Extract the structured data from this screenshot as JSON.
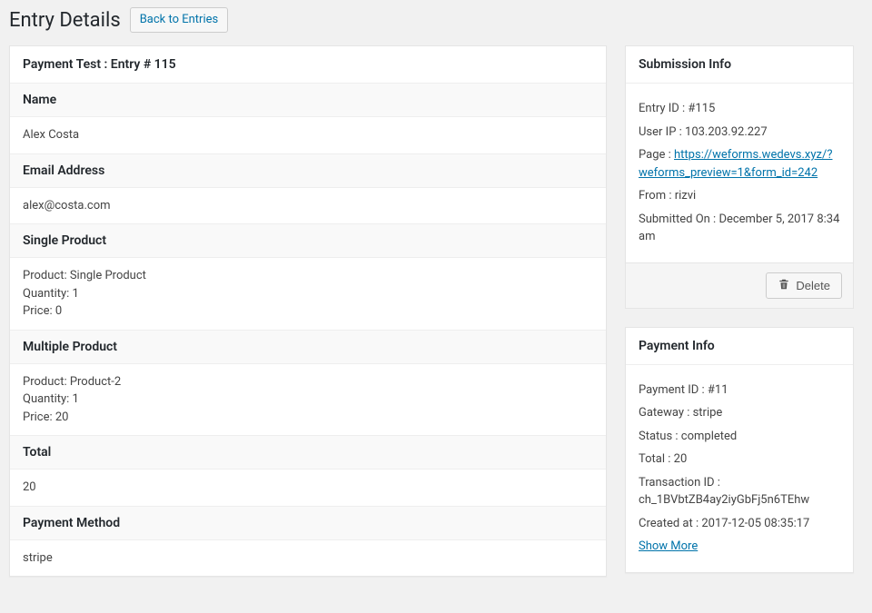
{
  "header": {
    "title": "Entry Details",
    "back_button": "Back to Entries"
  },
  "entry_panel": {
    "title": "Payment Test : Entry # 115",
    "fields": [
      {
        "label": "Name",
        "value": "Alex Costa"
      },
      {
        "label": "Email Address",
        "value": "alex@costa.com"
      },
      {
        "label": "Single Product",
        "value": "Product: Single Product\nQuantity: 1\nPrice: 0"
      },
      {
        "label": "Multiple Product",
        "value": "Product: Product-2\nQuantity: 1\nPrice: 20"
      },
      {
        "label": "Total",
        "value": "20"
      },
      {
        "label": "Payment Method",
        "value": "stripe"
      }
    ]
  },
  "submission_info": {
    "title": "Submission Info",
    "entry_id_label": "Entry ID :",
    "entry_id": "#115",
    "user_ip_label": "User IP :",
    "user_ip": "103.203.92.227",
    "page_label": "Page :",
    "page_url": "https://weforms.wedevs.xyz/?weforms_preview=1&form_id=242",
    "from_label": "From :",
    "from": "rizvi",
    "submitted_label": "Submitted On :",
    "submitted": "December 5, 2017 8:34 am",
    "delete_label": "Delete"
  },
  "payment_info": {
    "title": "Payment Info",
    "payment_id_label": "Payment ID :",
    "payment_id": "#11",
    "gateway_label": "Gateway :",
    "gateway": "stripe",
    "status_label": "Status :",
    "status": "completed",
    "total_label": "Total :",
    "total": "20",
    "transaction_label": "Transaction ID :",
    "transaction": "ch_1BVbtZB4ay2iyGbFj5n6TEhw",
    "created_label": "Created at :",
    "created": "2017-12-05 08:35:17",
    "show_more": "Show More"
  }
}
